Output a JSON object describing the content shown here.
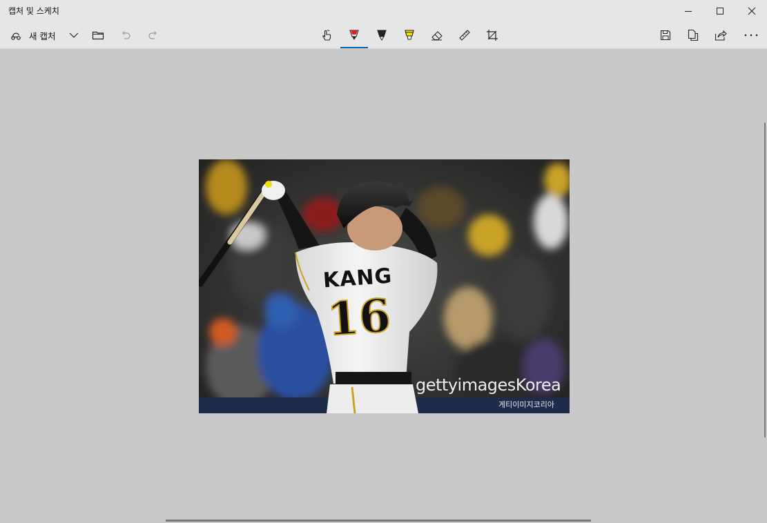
{
  "window": {
    "title": "캡처 및 스케치",
    "controls": [
      "minimize",
      "maximize",
      "close"
    ]
  },
  "toolbar": {
    "new_capture_label": "새 캡처",
    "left_icons": [
      "new-capture-icon",
      "chevron-down-icon",
      "folder-icon",
      "undo-icon",
      "redo-icon"
    ],
    "tools": [
      "touch-writing-icon",
      "ballpoint-pen-icon",
      "pencil-icon",
      "highlighter-icon",
      "eraser-icon",
      "ruler-icon",
      "crop-icon"
    ],
    "selected_tool": "ballpoint-pen",
    "right_icons": [
      "save-icon",
      "copy-icon",
      "share-icon",
      "more-icon"
    ],
    "accent_color": "#0063b1",
    "pen_color": "#d7201f",
    "highlighter_color": "#f2e600"
  },
  "image": {
    "jersey_name": "KANG",
    "jersey_number": "16",
    "watermark": "gettyimagesKorea",
    "watermark_sub": "게티이미지코리아"
  }
}
